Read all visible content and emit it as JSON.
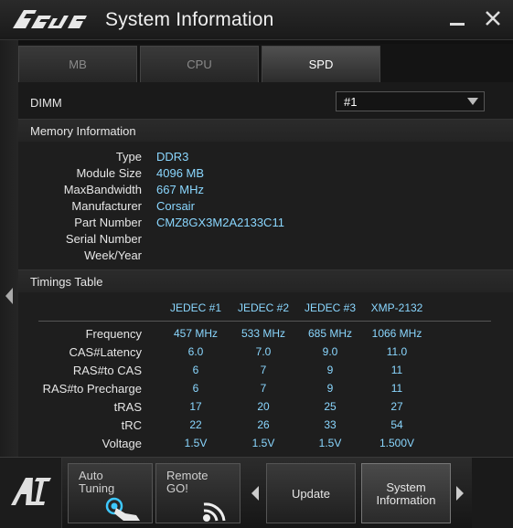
{
  "window": {
    "title": "System Information",
    "brand": "ASUS"
  },
  "tabs": [
    {
      "label": "MB"
    },
    {
      "label": "CPU"
    },
    {
      "label": "SPD"
    }
  ],
  "dimm": {
    "label": "DIMM",
    "selected": "#1"
  },
  "memory_info": {
    "header": "Memory Information",
    "rows": [
      {
        "label": "Type",
        "value": "DDR3"
      },
      {
        "label": "Module Size",
        "value": "4096 MB"
      },
      {
        "label": "MaxBandwidth",
        "value": "667 MHz"
      },
      {
        "label": "Manufacturer",
        "value": "Corsair"
      },
      {
        "label": "Part Number",
        "value": "CMZ8GX3M2A2133C11"
      },
      {
        "label": "Serial Number",
        "value": ""
      },
      {
        "label": "Week/Year",
        "value": ""
      }
    ]
  },
  "timings": {
    "header": "Timings Table",
    "columns": [
      "JEDEC #1",
      "JEDEC #2",
      "JEDEC #3",
      "XMP-2132"
    ],
    "rows": [
      {
        "label": "Frequency",
        "values": [
          "457 MHz",
          "533 MHz",
          "685 MHz",
          "1066 MHz"
        ]
      },
      {
        "label": "CAS#Latency",
        "values": [
          "6.0",
          "7.0",
          "9.0",
          "11.0"
        ]
      },
      {
        "label": "RAS#to CAS",
        "values": [
          "6",
          "7",
          "9",
          "11"
        ]
      },
      {
        "label": "RAS#to Precharge",
        "values": [
          "6",
          "7",
          "9",
          "11"
        ]
      },
      {
        "label": "tRAS",
        "values": [
          "17",
          "20",
          "25",
          "27"
        ]
      },
      {
        "label": "tRC",
        "values": [
          "22",
          "26",
          "33",
          "54"
        ]
      },
      {
        "label": "Voltage",
        "values": [
          "1.5V",
          "1.5V",
          "1.5V",
          "1.500V"
        ]
      }
    ]
  },
  "bottom": {
    "auto_tuning": {
      "line1": "Auto",
      "line2": "Tuning"
    },
    "remote_go": {
      "line1": "Remote",
      "line2": "GO!"
    },
    "update": "Update",
    "system_info": {
      "line1": "System",
      "line2": "Information"
    }
  },
  "colors": {
    "accent_value": "#8ad7ff",
    "background": "#1e1e1e"
  },
  "icons": [
    "asus-logo",
    "minimize-icon",
    "close-icon",
    "left-arrow-icon",
    "dropdown-caret-icon",
    "ai-suite-logo",
    "touch-hand-icon",
    "wifi-remote-icon",
    "right-arrow-icon"
  ]
}
